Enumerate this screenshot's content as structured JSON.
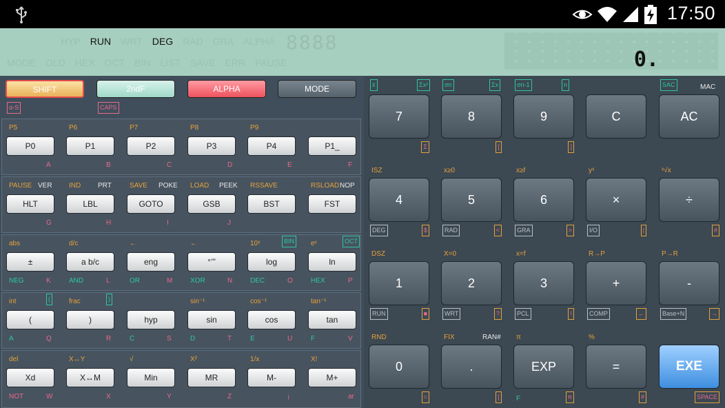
{
  "status_bar": {
    "time": "17:50",
    "icons": [
      "usb-icon",
      "eye-icon",
      "wifi-icon",
      "signal-icon",
      "battery-charging-icon"
    ]
  },
  "display": {
    "row1": [
      {
        "text": "HYP",
        "on": false
      },
      {
        "text": "RUN",
        "on": true
      },
      {
        "text": "WRT",
        "on": false
      },
      {
        "text": "DEG",
        "on": true
      },
      {
        "text": "RAD",
        "on": false
      },
      {
        "text": "GRA",
        "on": false
      },
      {
        "text": "ALPHA",
        "on": false
      }
    ],
    "row2": [
      {
        "text": "MODE",
        "on": false
      },
      {
        "text": "OLD",
        "on": false
      },
      {
        "text": "HEX",
        "on": false
      },
      {
        "text": "OCT",
        "on": false
      },
      {
        "text": "BIN",
        "on": false
      },
      {
        "text": "LIST",
        "on": false
      },
      {
        "text": "SAVE",
        "on": false
      },
      {
        "text": "ERR",
        "on": false
      },
      {
        "text": "PAUSE",
        "on": false
      }
    ],
    "segment_ghost": "8888",
    "value": "0."
  },
  "function_keys": [
    {
      "id": "shift",
      "label": "SHIFT"
    },
    {
      "id": "2ndf",
      "label": "2ndF"
    },
    {
      "id": "alpha",
      "label": "ALPHA"
    },
    {
      "id": "mode",
      "label": "MODE"
    }
  ],
  "mode_labels": {
    "alpha_s": "α-S",
    "caps": "CAPS"
  },
  "rows": [
    {
      "keys": [
        "P0",
        "P1",
        "P2",
        "P3",
        "P4",
        "P1_"
      ],
      "top": [
        [
          "P5",
          ""
        ],
        [
          "P6",
          ""
        ],
        [
          "P7",
          ""
        ],
        [
          "P8",
          ""
        ],
        [
          "P9",
          ""
        ],
        [
          "",
          ""
        ]
      ],
      "bottom": [
        [
          "",
          "A"
        ],
        [
          "",
          "B"
        ],
        [
          "",
          "C"
        ],
        [
          "",
          "D"
        ],
        [
          "",
          "E"
        ],
        [
          "",
          "F"
        ]
      ]
    },
    {
      "keys": [
        "HLT",
        "LBL",
        "GOTO",
        "GSB",
        "BST",
        "FST"
      ],
      "top": [
        [
          "PAUSE",
          "VER"
        ],
        [
          "IND",
          "PRT"
        ],
        [
          "SAVE",
          "POKE"
        ],
        [
          "LOAD",
          "PEEK"
        ],
        [
          "RSSAVE",
          ""
        ],
        [
          "RSLOAD",
          "NOP"
        ]
      ],
      "bottom": [
        [
          "",
          "G"
        ],
        [
          "",
          "H"
        ],
        [
          "",
          "I"
        ],
        [
          "",
          "J"
        ],
        [
          "",
          ""
        ],
        [
          "",
          ""
        ]
      ]
    },
    {
      "keys": [
        "±",
        "a b/c",
        "eng",
        "°’”",
        "log",
        "ln"
      ],
      "top": [
        [
          "abs",
          ""
        ],
        [
          "d/c",
          ""
        ],
        [
          "←",
          ""
        ],
        [
          "←",
          ""
        ],
        [
          "10ˣ",
          "BIN"
        ],
        [
          "eˣ",
          "OCT"
        ]
      ],
      "bottom": [
        [
          "NEG",
          "K"
        ],
        [
          "AND",
          "L"
        ],
        [
          "OR",
          "M"
        ],
        [
          "XOR",
          "N"
        ],
        [
          "DEC",
          "O"
        ],
        [
          "HEX",
          "P"
        ]
      ]
    },
    {
      "keys": [
        "(",
        ")",
        "hyp",
        "sin",
        "cos",
        "tan"
      ],
      "top": [
        [
          "int",
          "("
        ],
        [
          "frac",
          ")"
        ],
        [
          "",
          ""
        ],
        [
          "sin⁻¹",
          ""
        ],
        [
          "cos⁻¹",
          ""
        ],
        [
          "tan⁻¹",
          ""
        ]
      ],
      "bottom": [
        [
          "A",
          "Q"
        ],
        [
          "",
          "R"
        ],
        [
          "C",
          "S"
        ],
        [
          "D",
          "T"
        ],
        [
          "E",
          "U"
        ],
        [
          "F",
          "V"
        ]
      ]
    },
    {
      "keys": [
        "Xd",
        "X↔M",
        "Min",
        "MR",
        "M-",
        "M+"
      ],
      "top": [
        [
          "del",
          ""
        ],
        [
          "X↔Y",
          ""
        ],
        [
          "√",
          ""
        ],
        [
          "X²",
          ""
        ],
        [
          "1/x",
          ""
        ],
        [
          "X!",
          ""
        ]
      ],
      "bottom": [
        [
          "NOT",
          "W"
        ],
        [
          "",
          "X"
        ],
        [
          "",
          "Y"
        ],
        [
          "",
          "Z"
        ],
        [
          "",
          "¡"
        ],
        [
          "",
          "ar"
        ]
      ]
    }
  ],
  "big_rows": [
    {
      "keys": [
        "7",
        "8",
        "9",
        "C",
        "AC"
      ],
      "top": [
        [
          "x̄",
          "Σx²"
        ],
        [
          "σn",
          "Σx"
        ],
        [
          "σn-1",
          "n"
        ],
        [
          "",
          ""
        ],
        [
          "SAC",
          "MAC"
        ]
      ],
      "bottom": [
        [
          "",
          "Σ"
        ],
        [
          "",
          "["
        ],
        [
          "",
          "]"
        ],
        [
          "",
          ""
        ],
        [
          "",
          ""
        ]
      ]
    },
    {
      "keys": [
        "4",
        "5",
        "6",
        "×",
        "÷"
      ],
      "top": [
        [
          "ISZ",
          ""
        ],
        [
          "x≥0",
          ""
        ],
        [
          "x≥f",
          ""
        ],
        [
          "yˣ",
          ""
        ],
        [
          "ˣ√x",
          ""
        ]
      ],
      "bottom": [
        [
          "DEG",
          "$"
        ],
        [
          "RAD",
          "<"
        ],
        [
          "GRA",
          ">"
        ],
        [
          "I/O",
          "|"
        ],
        [
          "",
          "#"
        ]
      ]
    },
    {
      "keys": [
        "1",
        "2",
        "3",
        "+",
        "-"
      ],
      "top": [
        [
          "DSZ",
          ""
        ],
        [
          "X=0",
          ""
        ],
        [
          "x=f",
          ""
        ],
        [
          "R→P",
          ""
        ],
        [
          "P→R",
          ""
        ]
      ],
      "bottom": [
        [
          "RUN",
          "■"
        ],
        [
          "WRT",
          "?"
        ],
        [
          "PCL",
          "!"
        ],
        [
          "COMP",
          "←"
        ],
        [
          "Base+N",
          "→"
        ]
      ]
    },
    {
      "keys": [
        "0",
        ".",
        "EXP",
        "=",
        "EXE"
      ],
      "top": [
        [
          "RND",
          ""
        ],
        [
          "FIX",
          "RAN#"
        ],
        [
          "π",
          ""
        ],
        [
          "%",
          ""
        ],
        [
          "",
          ""
        ]
      ],
      "bottom": [
        [
          "",
          "="
        ],
        [
          "",
          "["
        ],
        [
          "F",
          "π"
        ],
        [
          "",
          "#"
        ],
        [
          "",
          "SPACE"
        ]
      ]
    }
  ],
  "colors": {
    "orange": "#e6a23c",
    "pink": "#e86a8c",
    "teal": "#2fc7a5",
    "gray": "#b9c1c7"
  }
}
